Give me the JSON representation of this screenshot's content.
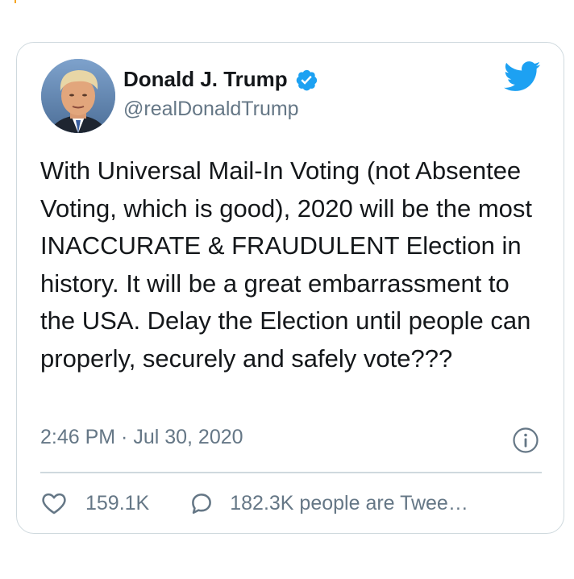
{
  "tweet": {
    "author": {
      "display_name": "Donald J. Trump",
      "handle": "@realDonaldTrump",
      "verified": true
    },
    "text": "With Universal Mail-In Voting (not Absentee Voting, which is good), 2020 will be the most INACCURATE & FRAUDULENT Election in history. It will be a great embarrassment to the USA. Delay the Election until people can properly, securely and safely vote???",
    "timestamp": "2:46 PM · Jul 30, 2020",
    "likes": "159.1K",
    "replies_label": "182.3K people are Twee…"
  },
  "icons": {
    "brand": "twitter-bird-icon",
    "verified": "verified-badge-icon",
    "info": "info-icon",
    "like": "heart-icon",
    "reply": "speech-bubble-icon"
  },
  "colors": {
    "twitter_blue": "#1da1f2",
    "text_primary": "#14171a",
    "text_secondary": "#657786",
    "border": "#cfd9de"
  }
}
